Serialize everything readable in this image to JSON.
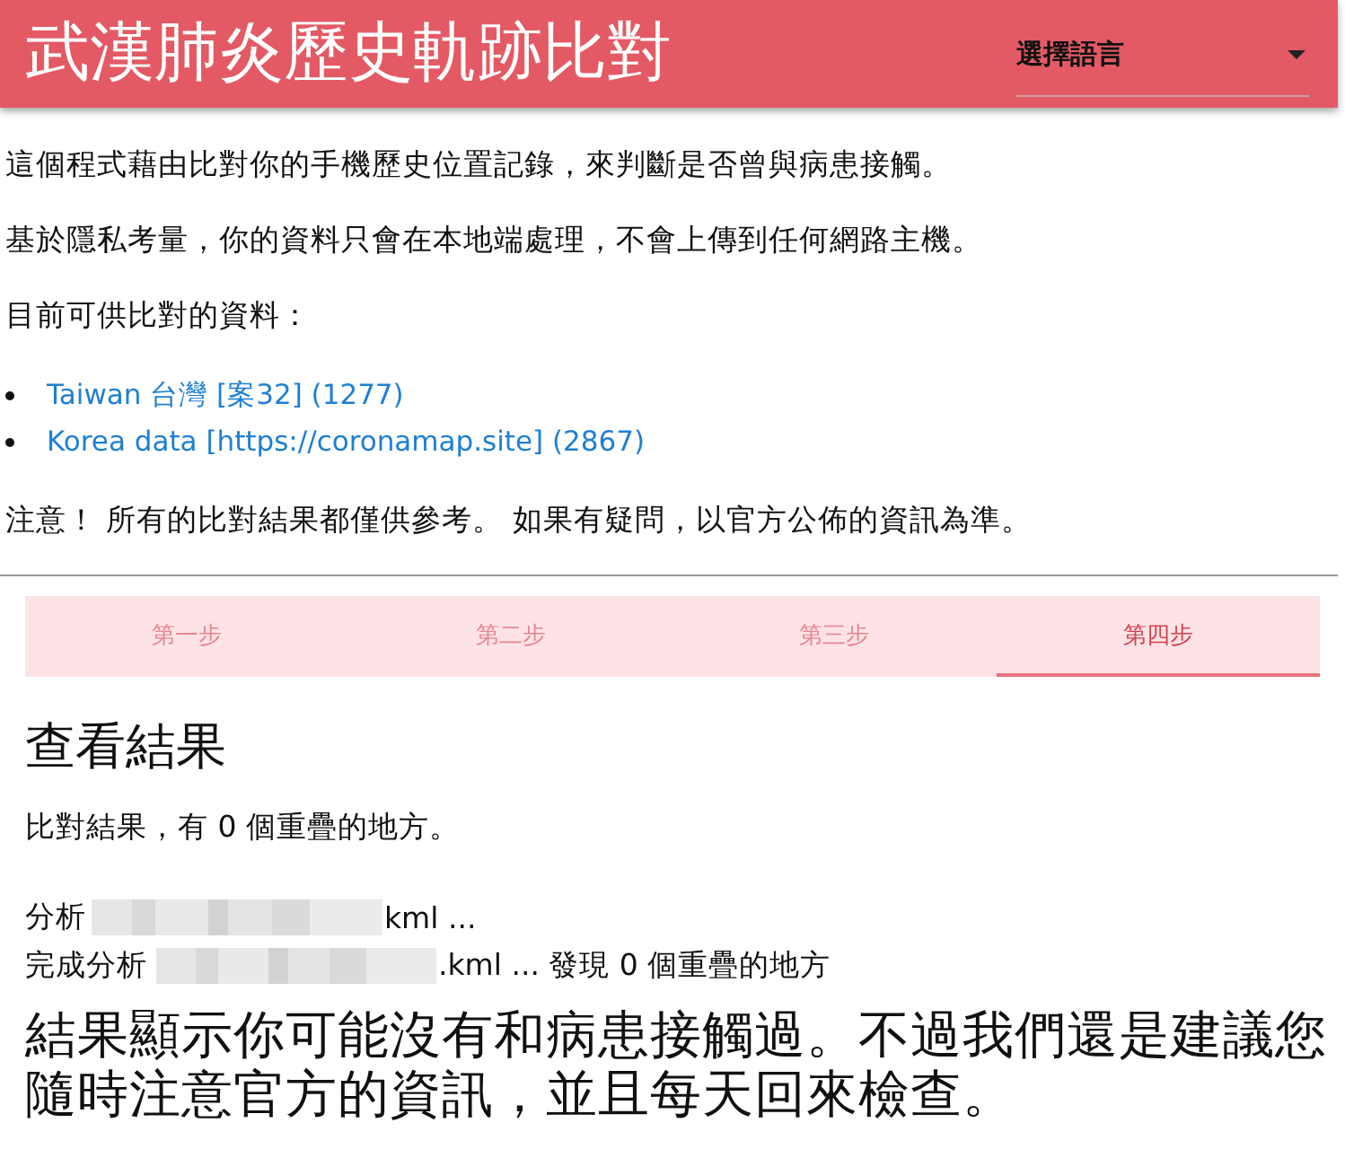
{
  "header": {
    "title": "武漢肺炎歷史軌跡比對",
    "language_select": {
      "label": "選擇語言"
    }
  },
  "intro": {
    "paragraphs": [
      "這個程式藉由比對你的手機歷史位置記錄，來判斷是否曾與病患接觸。",
      "基於隱私考量，你的資料只會在本地端處理，不會上傳到任何網路主機。",
      "目前可供比對的資料："
    ],
    "datasets": [
      {
        "name": "Taiwan 台灣 [案32] (1277)"
      },
      {
        "name": "Korea data [https://coronamap.site] (2867)"
      }
    ],
    "notice": "注意！ 所有的比對結果都僅供參考。 如果有疑問，以官方公佈的資訊為準。"
  },
  "steps": [
    {
      "label": "第一步",
      "selected": false
    },
    {
      "label": "第二步",
      "selected": false
    },
    {
      "label": "第三步",
      "selected": false
    },
    {
      "label": "第四步",
      "selected": true
    }
  ],
  "result": {
    "heading": "查看結果",
    "summary": "比對結果，有 0 個重疊的地方。",
    "log": [
      {
        "prefix": "分析",
        "redacted": true,
        "suffix": "kml ..."
      },
      {
        "prefix": "完成分析",
        "redacted": true,
        "suffix": ".kml ... 發現 0 個重疊的地方"
      }
    ],
    "conclusion": "結果顯示你可能沒有和病患接觸過。不過我們還是建議您隨時注意官方的資訊，並且每天回來檢查。"
  }
}
